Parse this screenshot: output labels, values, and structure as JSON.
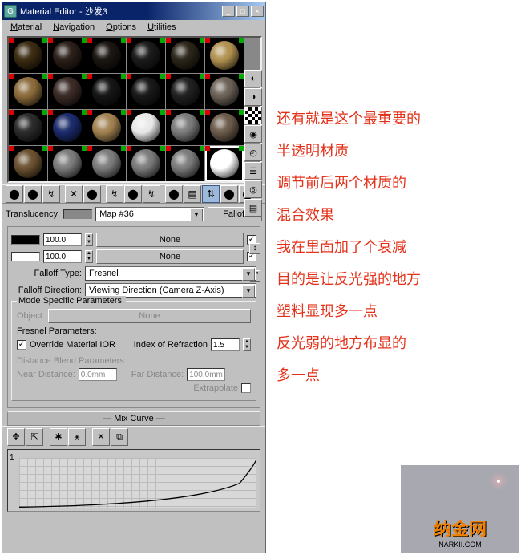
{
  "window": {
    "title": "Material Editor - 沙发3",
    "icon_letter": "G"
  },
  "menu": {
    "material": "Material",
    "navigation": "Navigation",
    "options": "Options",
    "utilities": "Utilities"
  },
  "win_btns": {
    "min": "_",
    "max": "□",
    "close": "×"
  },
  "side_icons": [
    "◐",
    "◑",
    "▒",
    "◉",
    "◴",
    "☰",
    "◎",
    "▤"
  ],
  "toolbar_icons": [
    "⬤",
    "⬤",
    "↯",
    "✕",
    "⬤",
    "↯",
    "⬤",
    "↯",
    "⬤",
    "▤",
    "⇅",
    "⬤",
    "⬤"
  ],
  "translucency": {
    "label": "Translucency:",
    "map": "Map #36",
    "type": "Falloff"
  },
  "falloff": {
    "amount1": "100.0",
    "map1": "None",
    "on1": "✓",
    "amount2": "100.0",
    "map2": "None",
    "on2": "✓",
    "type_label": "Falloff Type:",
    "type": "Fresnel",
    "dir_label": "Falloff Direction:",
    "dir": "Viewing Direction (Camera Z-Axis)"
  },
  "mode": {
    "header": "Mode Specific Parameters:",
    "object_label": "Object:",
    "object": "None",
    "fresnel_header": "Fresnel Parameters:",
    "override": "✓",
    "override_label": "Override Material IOR",
    "ior_label": "Index of Refraction",
    "ior": "1.5",
    "dist_header": "Distance Blend Parameters:",
    "near_label": "Near Distance:",
    "near": "0.0mm",
    "far_label": "Far Distance:",
    "far": "100.0mm",
    "extrapolate": "Extrapolate"
  },
  "mix_curve": {
    "header": "Mix Curve",
    "ylabel": "1",
    "tools": [
      "✥",
      "⇱",
      "✱",
      "⚹",
      "✕",
      "⧉"
    ]
  },
  "materials": [
    {
      "c": "#3a2a10"
    },
    {
      "c": "#2a1e18"
    },
    {
      "c": "#1a1510"
    },
    {
      "c": "#1a1a1a"
    },
    {
      "c": "#2a2418"
    },
    {
      "c": "#b09050"
    },
    {
      "c": "#8a6a3a"
    },
    {
      "c": "#3a2a25"
    },
    {
      "c": "#151515"
    },
    {
      "c": "#181818"
    },
    {
      "c": "#202020"
    },
    {
      "c": "#6a6055"
    },
    {
      "c": "#2a2a2a"
    },
    {
      "c": "#1a2a6a"
    },
    {
      "c": "#a08050",
      "p": true
    },
    {
      "c": "#e8e8e8"
    },
    {
      "c": "#7a7a7a"
    },
    {
      "c": "#6a5a4a"
    },
    {
      "c": "#6a5030"
    },
    {
      "c": "#7a7a7a"
    },
    {
      "c": "#7a7a7a"
    },
    {
      "c": "#7a7a7a"
    },
    {
      "c": "#7a7a7a"
    },
    {
      "c": "#ffffff",
      "sel": true
    }
  ],
  "annotation": {
    "l1": "还有就是这个最重要的",
    "l2": "半透明材质",
    "l3": "调节前后两个材质的",
    "l4": "混合效果",
    "l5": "我在里面加了个衰减",
    "l6": "目的是让反光强的地方",
    "l7": "塑料显现多一点",
    "l8": "反光弱的地方布显的",
    "l9": "多一点"
  },
  "logo": {
    "brand": "纳金网",
    "url": "NARKII.COM"
  }
}
